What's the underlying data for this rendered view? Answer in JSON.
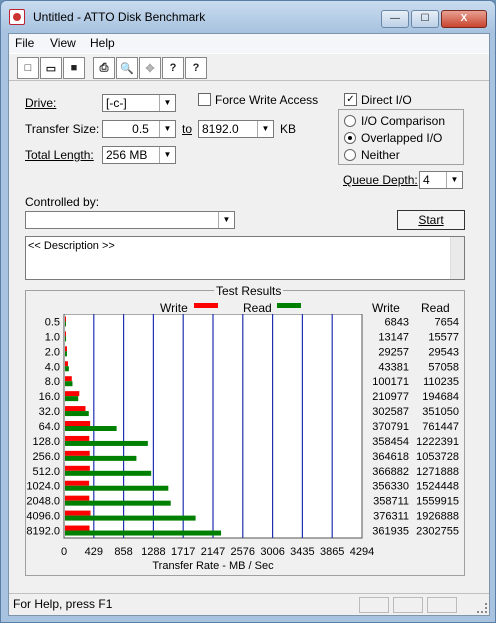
{
  "window": {
    "title": "Untitled - ATTO Disk Benchmark",
    "min": "—",
    "max": "☐",
    "close": "X"
  },
  "menu": [
    "File",
    "View",
    "Help"
  ],
  "toolbar": {
    "new": "□",
    "open": "▭",
    "save": "■",
    "print": "⎙",
    "preview": "🔍",
    "move": "✥",
    "help": "?",
    "context_help": "?"
  },
  "form": {
    "drive_label": "Drive:",
    "drive_value": "[-c-]",
    "force_write_label": "Force Write Access",
    "force_write_checked": false,
    "direct_io_label": "Direct I/O",
    "direct_io_checked": true,
    "transfer_size_label": "Transfer Size:",
    "ts_from": "0.5",
    "ts_to_label": "to",
    "ts_to": "8192.0",
    "ts_unit": "KB",
    "total_length_label": "Total Length:",
    "total_length": "256 MB",
    "io_options": [
      {
        "label": "I/O Comparison",
        "selected": false
      },
      {
        "label": "Overlapped I/O",
        "selected": true
      },
      {
        "label": "Neither",
        "selected": false
      }
    ],
    "queue_depth_label": "Queue Depth:",
    "queue_depth": "4",
    "controlled_by_label": "Controlled by:",
    "controlled_by": "",
    "start_label": "Start",
    "description": "<< Description >>"
  },
  "results": {
    "title": "Test Results",
    "legend_write": "Write",
    "legend_read": "Read",
    "col_write": "Write",
    "col_read": "Read",
    "write_color": "#ff0000",
    "read_color": "#008000"
  },
  "chart_data": {
    "type": "bar",
    "title": "Test Results",
    "xlabel": "Transfer Rate - MB / Sec",
    "xlim": [
      0,
      4294
    ],
    "x_ticks": [
      "0",
      "429",
      "858",
      "1288",
      "1717",
      "2147",
      "2576",
      "3006",
      "3435",
      "3865",
      "4294"
    ],
    "categories": [
      "0.5",
      "1.0",
      "2.0",
      "4.0",
      "8.0",
      "16.0",
      "32.0",
      "64.0",
      "128.0",
      "256.0",
      "512.0",
      "1024.0",
      "2048.0",
      "4096.0",
      "8192.0"
    ],
    "series": [
      {
        "name": "Write",
        "color": "#ff0000",
        "values": [
          6843,
          13147,
          29257,
          43381,
          100171,
          210977,
          302587,
          370791,
          358454,
          364618,
          366882,
          356330,
          358711,
          376311,
          361935
        ]
      },
      {
        "name": "Read",
        "color": "#008000",
        "values": [
          7654,
          15577,
          29543,
          57058,
          110235,
          194684,
          351050,
          761447,
          1222391,
          1053728,
          1271888,
          1524448,
          1559915,
          1926888,
          2302755
        ]
      }
    ],
    "grid": true
  },
  "status": {
    "text": "For Help, press F1"
  }
}
